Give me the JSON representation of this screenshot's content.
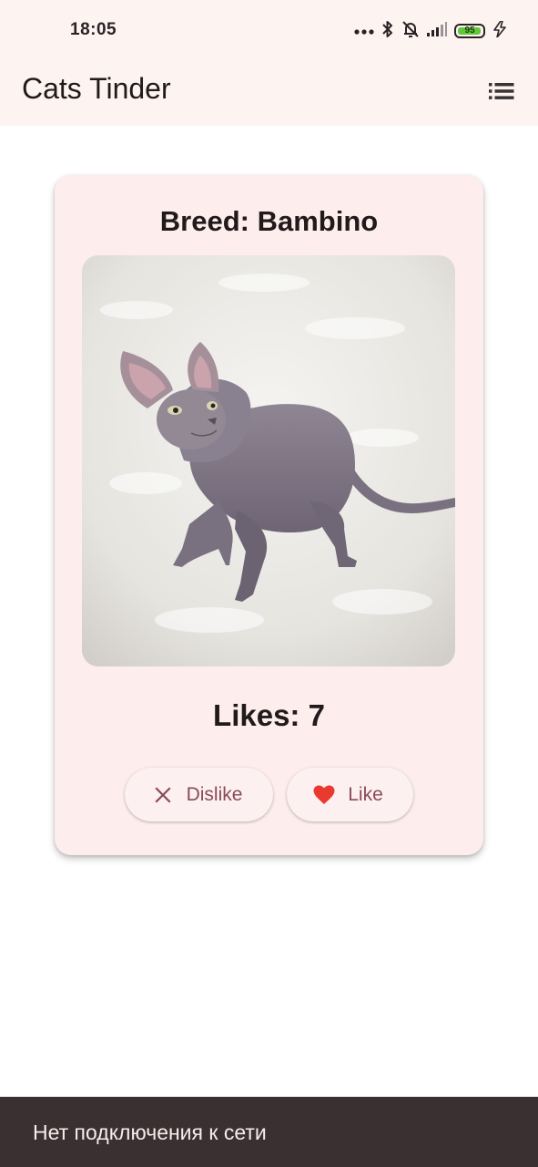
{
  "status_bar": {
    "time": "18:05",
    "battery_level": "95",
    "icons": [
      "more-dots-icon",
      "bluetooth-icon",
      "alarm-off-icon",
      "signal-icon",
      "battery-icon",
      "charging-icon"
    ],
    "battery_color": "#5fc93a"
  },
  "app_bar": {
    "title": "Cats Tinder",
    "menu_icon": "list-icon"
  },
  "card": {
    "breed": "Breed: Bambino",
    "likes": "Likes: 7",
    "dislike_label": "Dislike",
    "like_label": "Like",
    "dislike_icon": "close-icon",
    "like_icon": "heart-icon",
    "like_icon_color": "#ea3a2f"
  },
  "snackbar": {
    "message": "Нет подключения к сети"
  },
  "colors": {
    "app_bar_bg": "#fdf3f1",
    "card_bg": "#fdeeed",
    "button_text": "#8a4a5a",
    "snackbar_bg": "#3b3031"
  }
}
